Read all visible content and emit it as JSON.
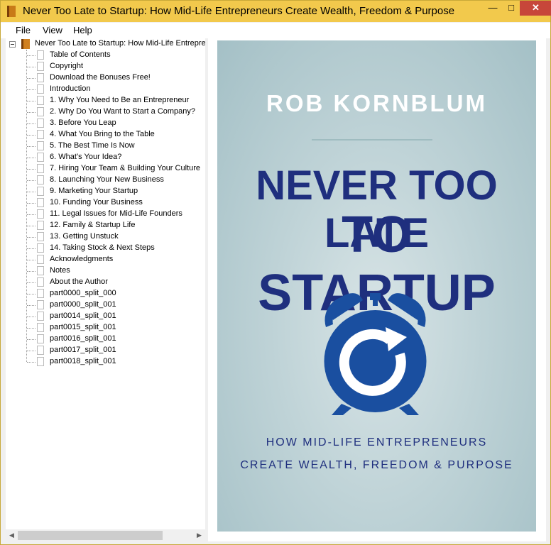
{
  "window": {
    "title": "Never Too Late to Startup: How Mid-Life Entrepreneurs Create Wealth, Freedom & Purpose",
    "minimize": "—",
    "maximize": "□",
    "close": "✕"
  },
  "menu": {
    "file": "File",
    "view": "View",
    "help": "Help"
  },
  "tree": {
    "root_label": "Never Too Late to Startup: How Mid-Life Entreprene",
    "items": [
      "Table of Contents",
      "Copyright",
      "Download the Bonuses Free!",
      "Introduction",
      "1. Why You Need to Be an Entrepreneur",
      "2. Why Do You Want to Start a Company?",
      "3. Before You Leap",
      "4. What You Bring to the Table",
      "5. The Best Time Is Now",
      "6. What’s Your Idea?",
      "7. Hiring Your Team & Building Your Culture",
      "8. Launching Your New Business",
      "9. Marketing Your Startup",
      "10. Funding Your Business",
      "11. Legal Issues for Mid-Life Founders",
      "12. Family & Startup Life",
      "13. Getting Unstuck",
      "14. Taking Stock & Next Steps",
      "Acknowledgments",
      "Notes",
      "About the Author",
      "part0000_split_000",
      "part0000_split_001",
      "part0014_split_001",
      "part0015_split_001",
      "part0016_split_001",
      "part0017_split_001",
      "part0018_split_001"
    ]
  },
  "scrollbar": {
    "left_arrow": "◀",
    "right_arrow": "▶"
  },
  "cover": {
    "author": "ROB KORNBLUM",
    "title_line1": "NEVER TOO LATE",
    "title_line2": "TO STARTUP",
    "subtitle_line1": "HOW MID-LIFE ENTREPRENEURS",
    "subtitle_line2": "CREATE WEALTH, FREEDOM & PURPOSE",
    "title_color": "#1f2f7e",
    "clock_color": "#1a4fa0",
    "background_color": "#b9cfd3"
  },
  "icons": {
    "app": "book-icon",
    "folder": "book-icon",
    "page": "page-icon",
    "cover_art": "alarm-clock-icon"
  }
}
